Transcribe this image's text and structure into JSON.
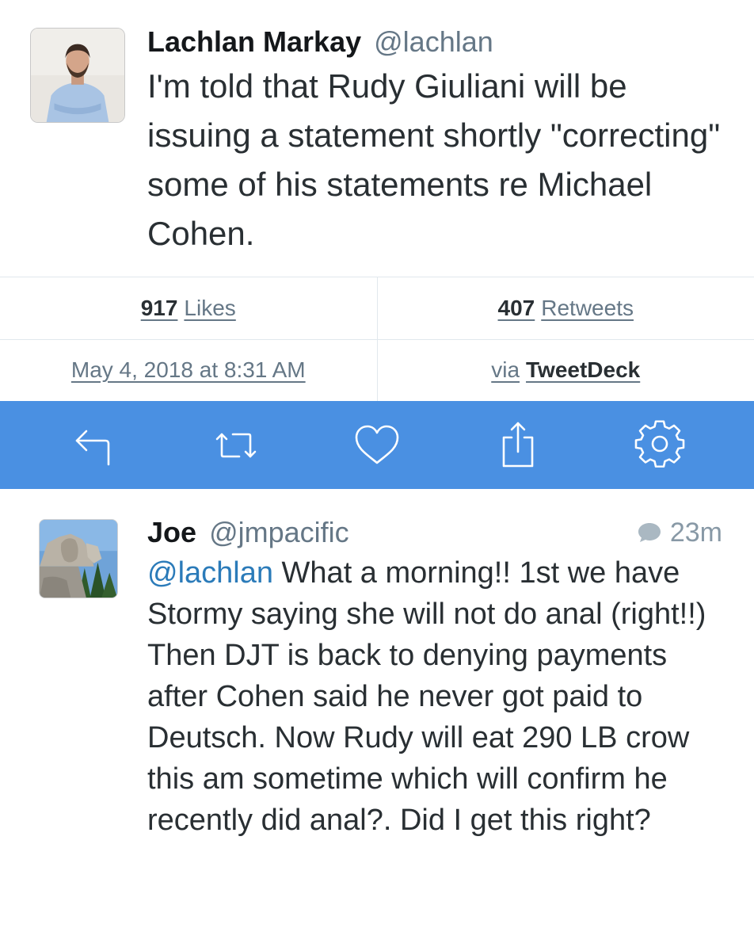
{
  "tweet": {
    "author_name": "Lachlan Markay",
    "handle": "@lachlan",
    "text": "I'm told that Rudy Giuliani will be issuing a statement shortly \"correcting\" some of his statements re Michael Cohen."
  },
  "stats": {
    "likes_count": "917",
    "likes_label": "Likes",
    "retweets_count": "407",
    "retweets_label": "Retweets",
    "timestamp": "May 4, 2018 at 8:31 AM",
    "via_label": "via",
    "client": "TweetDeck"
  },
  "toolbar": {
    "background_color": "#4a90e2",
    "icons": [
      "reply-icon",
      "retweet-icon",
      "like-icon",
      "share-icon",
      "settings-icon"
    ]
  },
  "reply": {
    "author_name": "Joe",
    "handle": "@jmpacific",
    "time": "23m",
    "mention": "@lachlan",
    "text": " What a morning!! 1st we have Stormy saying she will not do anal (right!!) Then DJT is back to denying payments after Cohen said he never got paid to Deutsch. Now Rudy will eat 290 LB crow this am sometime which will confirm he recently did anal?. Did I get this right?"
  }
}
